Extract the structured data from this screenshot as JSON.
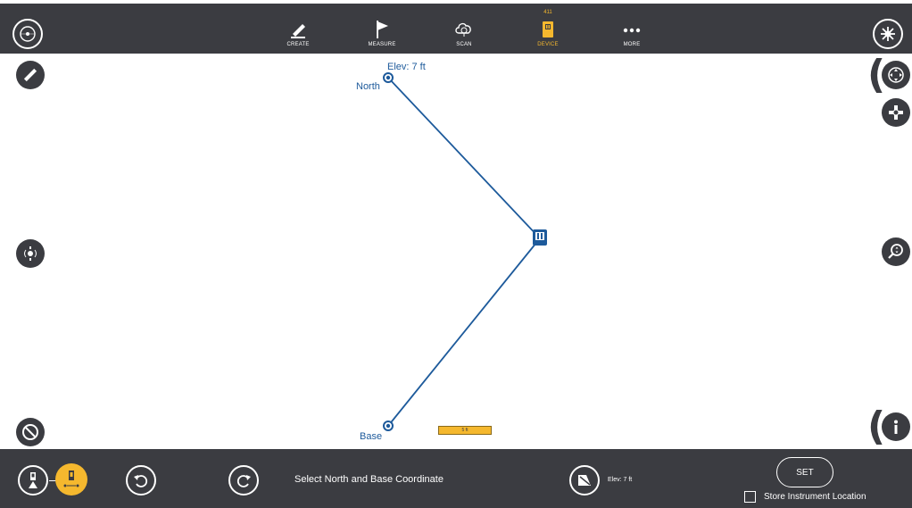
{
  "toolbar": {
    "create_label": "CREATE",
    "measure_label": "MEASURE",
    "scan_label": "SCAN",
    "device_label": "DEVICE",
    "device_badge": "411",
    "more_label": "MORE",
    "active_tab": "DEVICE",
    "active_color": "#f5b82e",
    "bar_color": "#3b3c41"
  },
  "map": {
    "north_label": "North",
    "north_elev": "Elev: 7 ft",
    "base_label": "Base",
    "scale_label": "5 ft",
    "line_color": "#1d5a9b"
  },
  "icons": {
    "top_left": "compass-icon",
    "top_right": "sun-icon",
    "left": [
      "ruler-icon",
      "instrument-radio-icon",
      "prohibited-icon"
    ],
    "right": [
      "move-icon",
      "crosshair-icon",
      "zoom-icon",
      "info-icon"
    ]
  },
  "bottom": {
    "instruction": "Select North and Base Coordinate",
    "elev_text": "Elev: 7 ft",
    "set_label": "SET",
    "store_label": "Store Instrument Location"
  }
}
